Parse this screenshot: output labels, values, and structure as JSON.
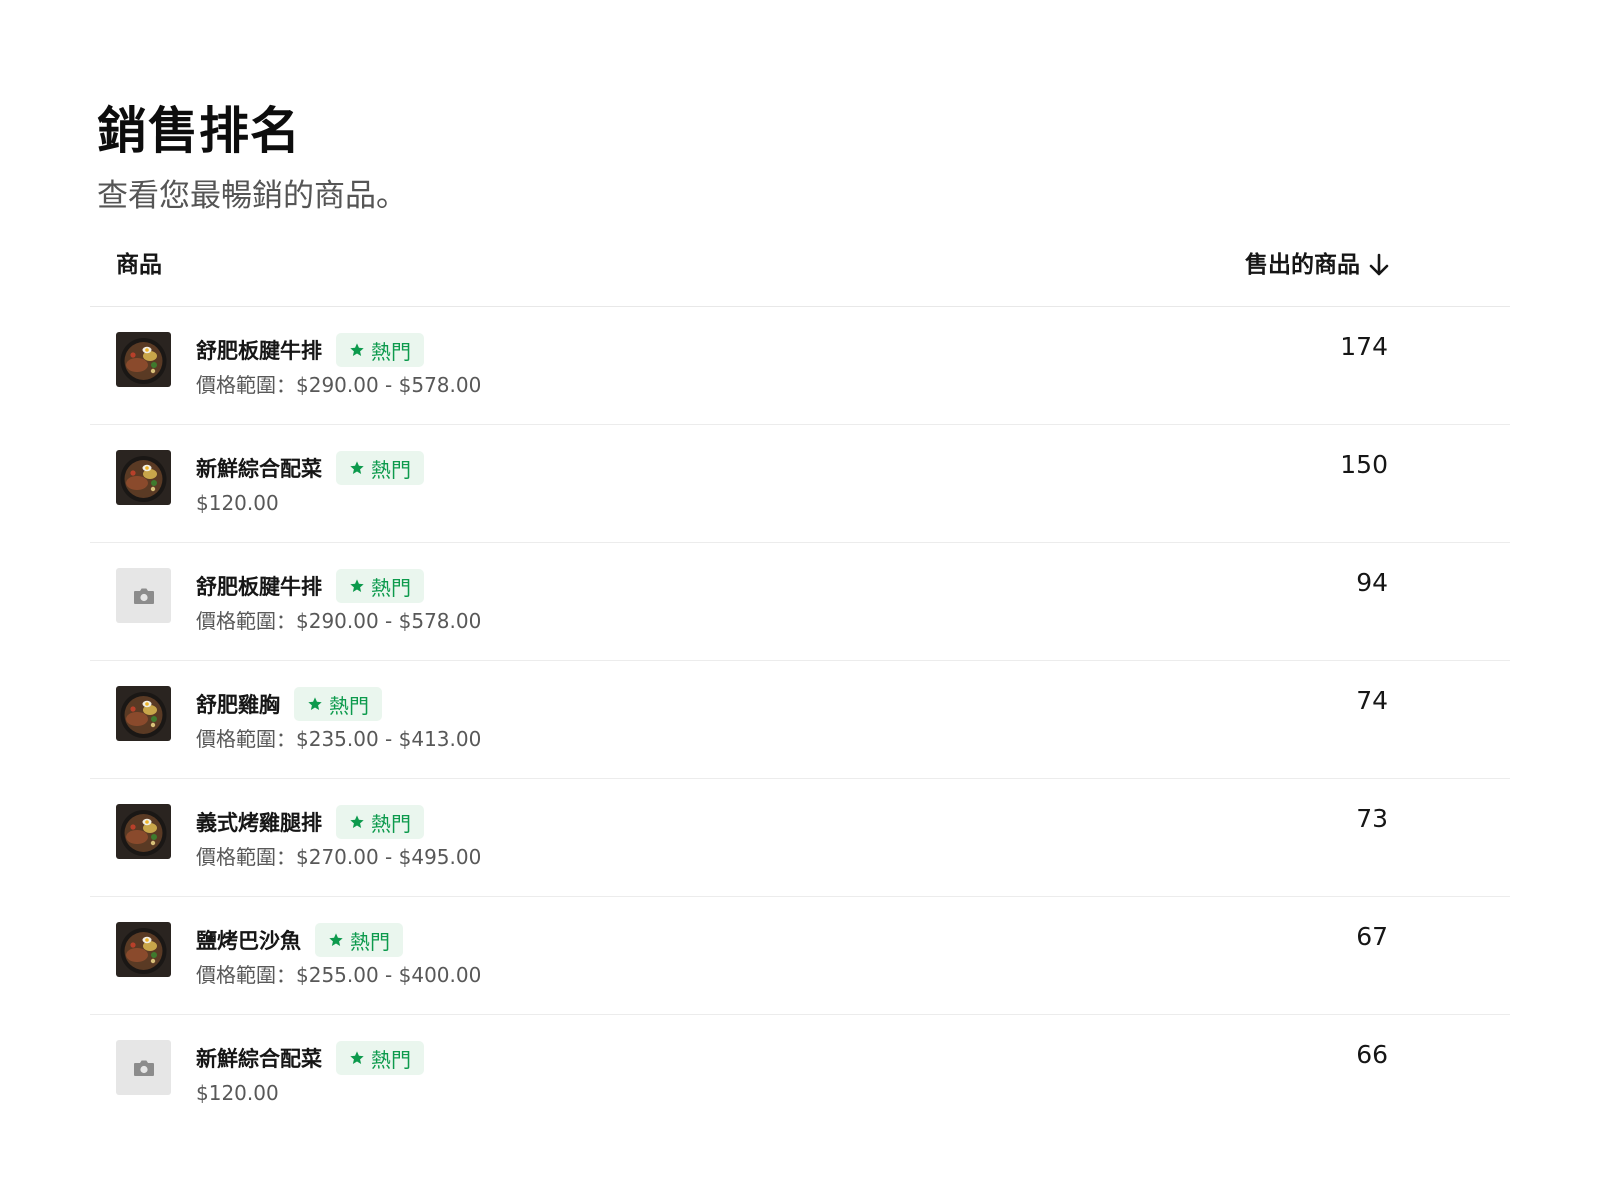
{
  "page": {
    "title": "銷售排名",
    "subtitle": "查看您最暢銷的商品。"
  },
  "table": {
    "columns": {
      "product": "商品",
      "sold": "售出的商品"
    },
    "sort_icon": "arrow-down-icon",
    "badge_icon": "star-icon",
    "rows": [
      {
        "name": "舒肥板腱牛排",
        "badge": "熱門",
        "price": "價格範圍：$290.00 - $578.00",
        "sold": "174",
        "thumbnail": "food-photo"
      },
      {
        "name": "新鮮綜合配菜",
        "badge": "熱門",
        "price": "$120.00",
        "sold": "150",
        "thumbnail": "food-photo"
      },
      {
        "name": "舒肥板腱牛排",
        "badge": "熱門",
        "price": "價格範圍：$290.00 - $578.00",
        "sold": "94",
        "thumbnail": "camera-placeholder-icon"
      },
      {
        "name": "舒肥雞胸",
        "badge": "熱門",
        "price": "價格範圍：$235.00 - $413.00",
        "sold": "74",
        "thumbnail": "food-photo"
      },
      {
        "name": "義式烤雞腿排",
        "badge": "熱門",
        "price": "價格範圍：$270.00 - $495.00",
        "sold": "73",
        "thumbnail": "food-photo"
      },
      {
        "name": "鹽烤巴沙魚",
        "badge": "熱門",
        "price": "價格範圍：$255.00 - $400.00",
        "sold": "67",
        "thumbnail": "food-photo"
      },
      {
        "name": "新鮮綜合配菜",
        "badge": "熱門",
        "price": "$120.00",
        "sold": "66",
        "thumbnail": "camera-placeholder-icon"
      }
    ]
  },
  "colors": {
    "badge_text": "#0c9a4c",
    "badge_bg": "#eaf6ee",
    "divider": "#ececec",
    "price_text": "#585858"
  }
}
